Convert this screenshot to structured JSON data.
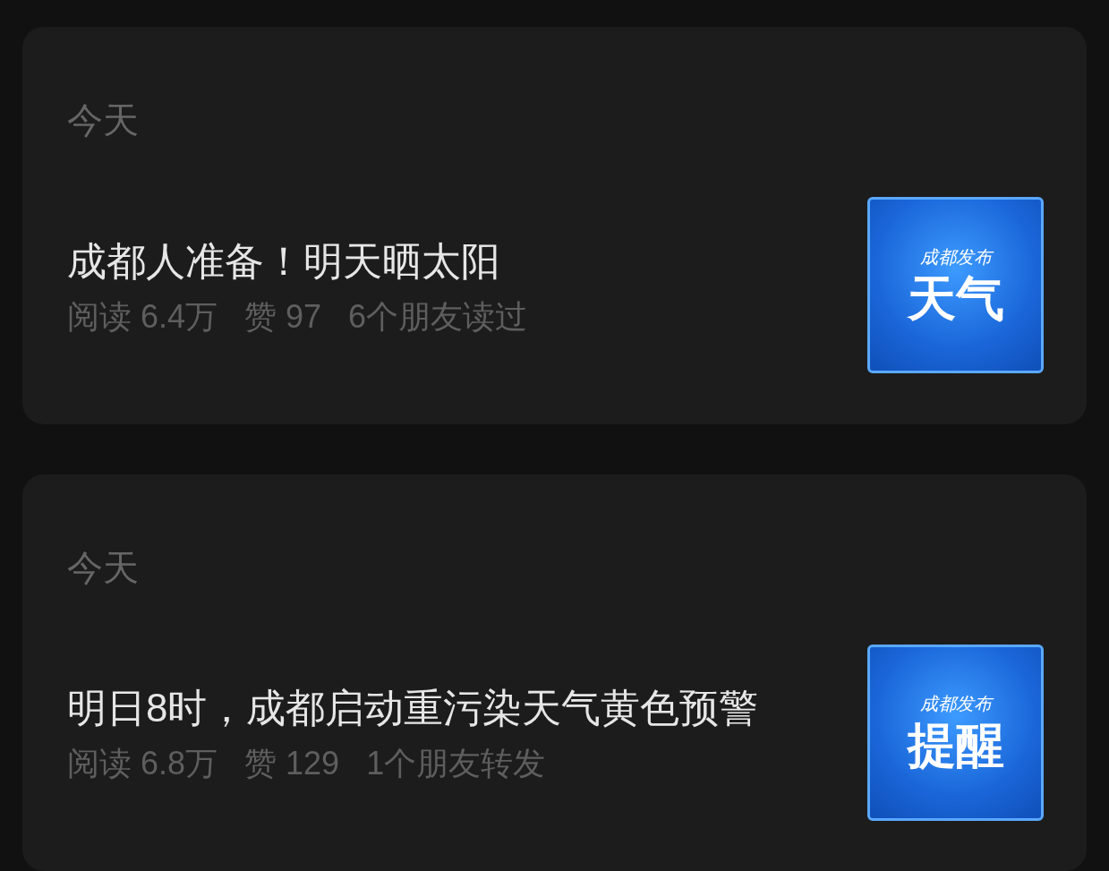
{
  "articles": [
    {
      "date": "今天",
      "title": "成都人准备！明天晒太阳",
      "stats": [
        "阅读 6.4万",
        "赞 97",
        "6个朋友读过"
      ],
      "cover": {
        "brand": "成都发布",
        "label": "天气"
      }
    },
    {
      "date": "今天",
      "title": "明日8时，成都启动重污染天气黄色预警",
      "stats": [
        "阅读 6.8万",
        "赞 129",
        "1个朋友转发"
      ],
      "cover": {
        "brand": "成都发布",
        "label": "提醒"
      }
    }
  ]
}
